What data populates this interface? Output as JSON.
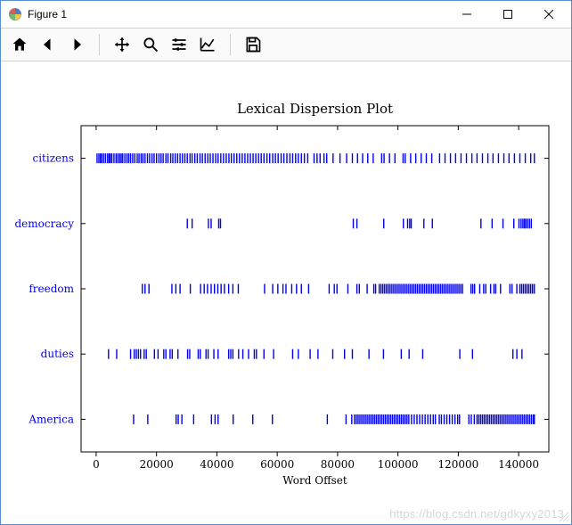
{
  "window": {
    "title": "Figure 1"
  },
  "toolbar": {
    "home": "Home",
    "back": "Back",
    "forward": "Forward",
    "pan": "Pan",
    "zoom": "Zoom",
    "subplots": "Configure subplots",
    "axes": "Edit axis",
    "save": "Save"
  },
  "watermark": "https://blog.csdn.net/gdkyxy2013",
  "chart_data": {
    "type": "dispersion",
    "title": "Lexical Dispersion Plot",
    "xlabel": "Word Offset",
    "ylabel": "",
    "xlim": [
      -5000,
      150000
    ],
    "xticks": [
      0,
      20000,
      40000,
      60000,
      80000,
      100000,
      120000,
      140000
    ],
    "categories": [
      "citizens",
      "democracy",
      "freedom",
      "duties",
      "America"
    ],
    "series": [
      {
        "name": "citizens",
        "offsets": [
          300,
          900,
          1400,
          1900,
          2500,
          3100,
          3800,
          4300,
          4700,
          5200,
          5900,
          6600,
          7200,
          7800,
          8300,
          8800,
          9500,
          10200,
          10800,
          11400,
          12100,
          12800,
          13600,
          14200,
          14900,
          15500,
          16200,
          17000,
          17700,
          18500,
          19200,
          20000,
          20800,
          21500,
          22200,
          23100,
          23800,
          24700,
          25400,
          26200,
          27000,
          27800,
          28600,
          29400,
          30200,
          31100,
          31800,
          32700,
          33500,
          34400,
          35200,
          36100,
          37000,
          37800,
          38700,
          39600,
          40400,
          41300,
          42200,
          43100,
          44000,
          44800,
          45700,
          46600,
          47500,
          48400,
          49300,
          50200,
          51100,
          52000,
          52900,
          53800,
          54700,
          55600,
          56600,
          57500,
          58500,
          59400,
          60300,
          61300,
          62200,
          63200,
          64200,
          65100,
          66100,
          67000,
          68000,
          69000,
          70100,
          72200,
          73200,
          74200,
          75500,
          76400,
          78500,
          80800,
          83000,
          84900,
          86600,
          88300,
          90000,
          91800,
          94600,
          95400,
          97200,
          99000,
          101700,
          102400,
          104200,
          105900,
          107700,
          109400,
          111200,
          113800,
          115600,
          117400,
          119100,
          120900,
          122700,
          124500,
          126200,
          128000,
          129800,
          131500,
          133300,
          135100,
          136800,
          138600,
          140400,
          142200,
          144000,
          145200
        ]
      },
      {
        "name": "democracy",
        "offsets": [
          30200,
          31800,
          37200,
          38100,
          40600,
          41200,
          85200,
          86400,
          95300,
          101800,
          103200,
          103900,
          104400,
          108600,
          111400,
          127500,
          131200,
          134800,
          138400,
          140100,
          140800,
          141400,
          141900,
          142400,
          143000,
          143600,
          144200
        ]
      },
      {
        "name": "freedom",
        "offsets": [
          15300,
          16200,
          17500,
          25100,
          26400,
          27800,
          31200,
          34600,
          35800,
          36900,
          38100,
          39200,
          40300,
          41400,
          42500,
          43900,
          45300,
          47100,
          55800,
          58500,
          60200,
          61900,
          62900,
          64800,
          66400,
          68000,
          70400,
          77200,
          78900,
          79800,
          83400,
          86400,
          87200,
          89800,
          92000,
          92600,
          93800,
          94400,
          95000,
          95600,
          96200,
          96800,
          97400,
          98000,
          98600,
          99200,
          99800,
          100400,
          101000,
          101600,
          102200,
          102800,
          103400,
          104000,
          104600,
          105200,
          105800,
          106400,
          107000,
          107600,
          108200,
          108800,
          109400,
          110000,
          110600,
          111200,
          111800,
          112400,
          113000,
          113600,
          114200,
          114800,
          115400,
          116000,
          116600,
          117200,
          117800,
          118400,
          119000,
          119600,
          120200,
          120800,
          121400,
          124200,
          124800,
          125400,
          127100,
          128400,
          129100,
          130700,
          131800,
          132400,
          134000,
          137100,
          137800,
          139400,
          140400,
          141000,
          141600,
          142200,
          142800,
          143400,
          144000,
          144600,
          145200
        ]
      },
      {
        "name": "duties",
        "offsets": [
          4100,
          6800,
          11400,
          12600,
          13300,
          14000,
          14700,
          15900,
          16600,
          19300,
          20500,
          22400,
          23100,
          24500,
          25200,
          27100,
          30300,
          31000,
          33800,
          34500,
          36400,
          37100,
          39000,
          40400,
          43900,
          44600,
          45300,
          47200,
          48600,
          50500,
          52400,
          53100,
          55600,
          58800,
          65100,
          67000,
          70900,
          73500,
          78400,
          82300,
          84900,
          90400,
          95200,
          101100,
          103700,
          108200,
          120500,
          124700,
          138100,
          139400,
          141100
        ]
      },
      {
        "name": "America",
        "offsets": [
          12400,
          17100,
          26500,
          27200,
          28400,
          32300,
          38200,
          39400,
          40400,
          45400,
          51900,
          58400,
          76600,
          82800,
          84700,
          85600,
          86200,
          86800,
          87400,
          88000,
          88600,
          89200,
          89800,
          90400,
          91000,
          91600,
          92200,
          92800,
          93400,
          94000,
          94600,
          95200,
          95800,
          96400,
          97000,
          97600,
          98200,
          98800,
          99400,
          100000,
          100600,
          101200,
          101800,
          102400,
          103000,
          103600,
          104500,
          105400,
          106300,
          107200,
          108100,
          109000,
          109900,
          110800,
          111700,
          112400,
          113700,
          114400,
          115300,
          116200,
          117100,
          118000,
          118900,
          119800,
          120400,
          123500,
          124300,
          125300,
          126200,
          126800,
          127400,
          128000,
          128600,
          129200,
          129800,
          130400,
          131000,
          131600,
          132200,
          132800,
          133400,
          134000,
          134600,
          135200,
          135800,
          136400,
          137000,
          137600,
          138200,
          138800,
          139400,
          140000,
          140600,
          141200,
          141800,
          142400,
          143000,
          143600,
          144200,
          144800,
          145200
        ]
      }
    ]
  }
}
